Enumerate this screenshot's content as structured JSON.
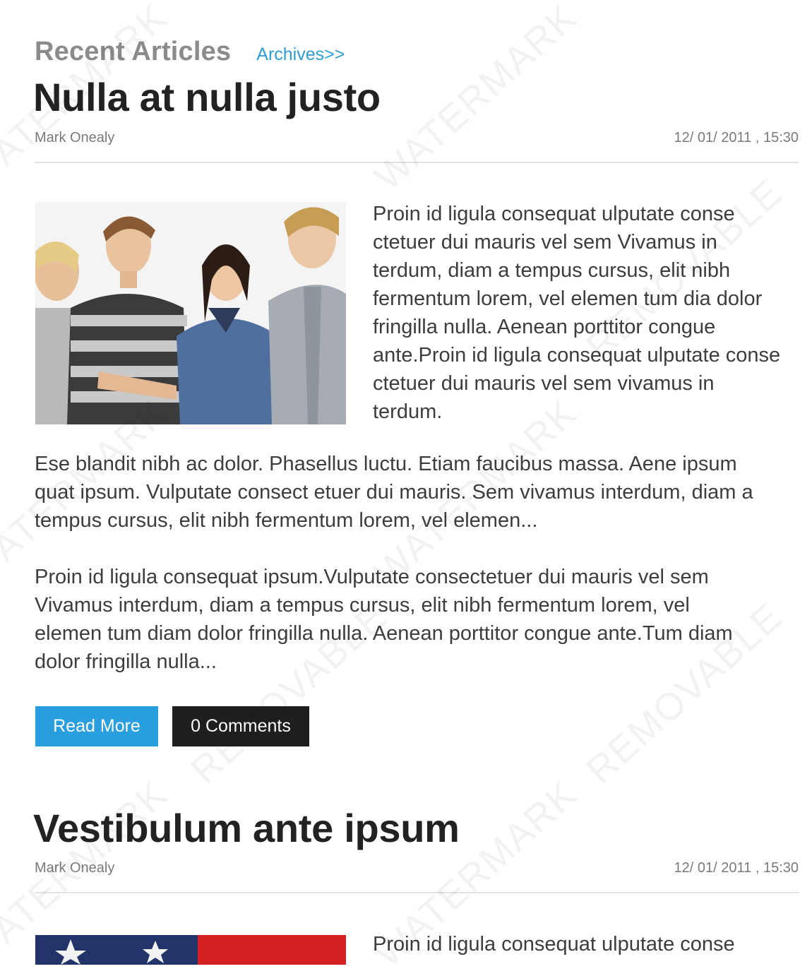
{
  "header": {
    "title": "Recent Articles",
    "archives_link": "Archives>>"
  },
  "articles": [
    {
      "title": "Nulla at nulla justo",
      "author": "Mark Onealy",
      "date": "12/ 01/ 2011 , 15:30",
      "intro": "Proin id ligula consequat ulputate conse ctetuer dui mauris vel sem Vivamus in terdum, diam a tempus cursus, elit nibh fermentum lorem, vel elemen tum dia dolor fringilla nulla. Aenean porttitor congue ante.Proin id ligula consequat ulputate conse ctetuer dui mauris vel sem vivamus in terdum.",
      "paragraph_1": "Ese blandit nibh ac dolor. Phasellus luctu. Etiam faucibus massa. Aene ipsum quat ipsum. Vulputate consect etuer dui mauris. Sem vivamus interdum, diam a tempus cursus, elit nibh fermentum lorem, vel elemen...",
      "paragraph_2": "Proin id ligula consequat ipsum.Vulputate consectetuer dui mauris vel sem Vivamus interdum, diam a tempus cursus, elit nibh fermentum lorem, vel elemen tum diam dolor fringilla nulla. Aenean porttitor congue ante.Tum diam dolor fringilla nulla...",
      "read_more_label": "Read More",
      "comments_label": "0 Comments",
      "image_icon": "group-of-teens-photo"
    },
    {
      "title": "Vestibulum ante ipsum",
      "author": "Mark Onealy",
      "date": "12/ 01/ 2011 , 15:30",
      "intro": "Proin id ligula consequat ulputate conse",
      "image_icon": "american-flag-photo"
    }
  ],
  "watermark": {
    "text_1": "WATERMARK",
    "text_2": "REMOVABLE"
  },
  "colors": {
    "accent": "#2a9fe0",
    "link": "#2c9fd6",
    "dark_button": "#1f1f1f"
  }
}
